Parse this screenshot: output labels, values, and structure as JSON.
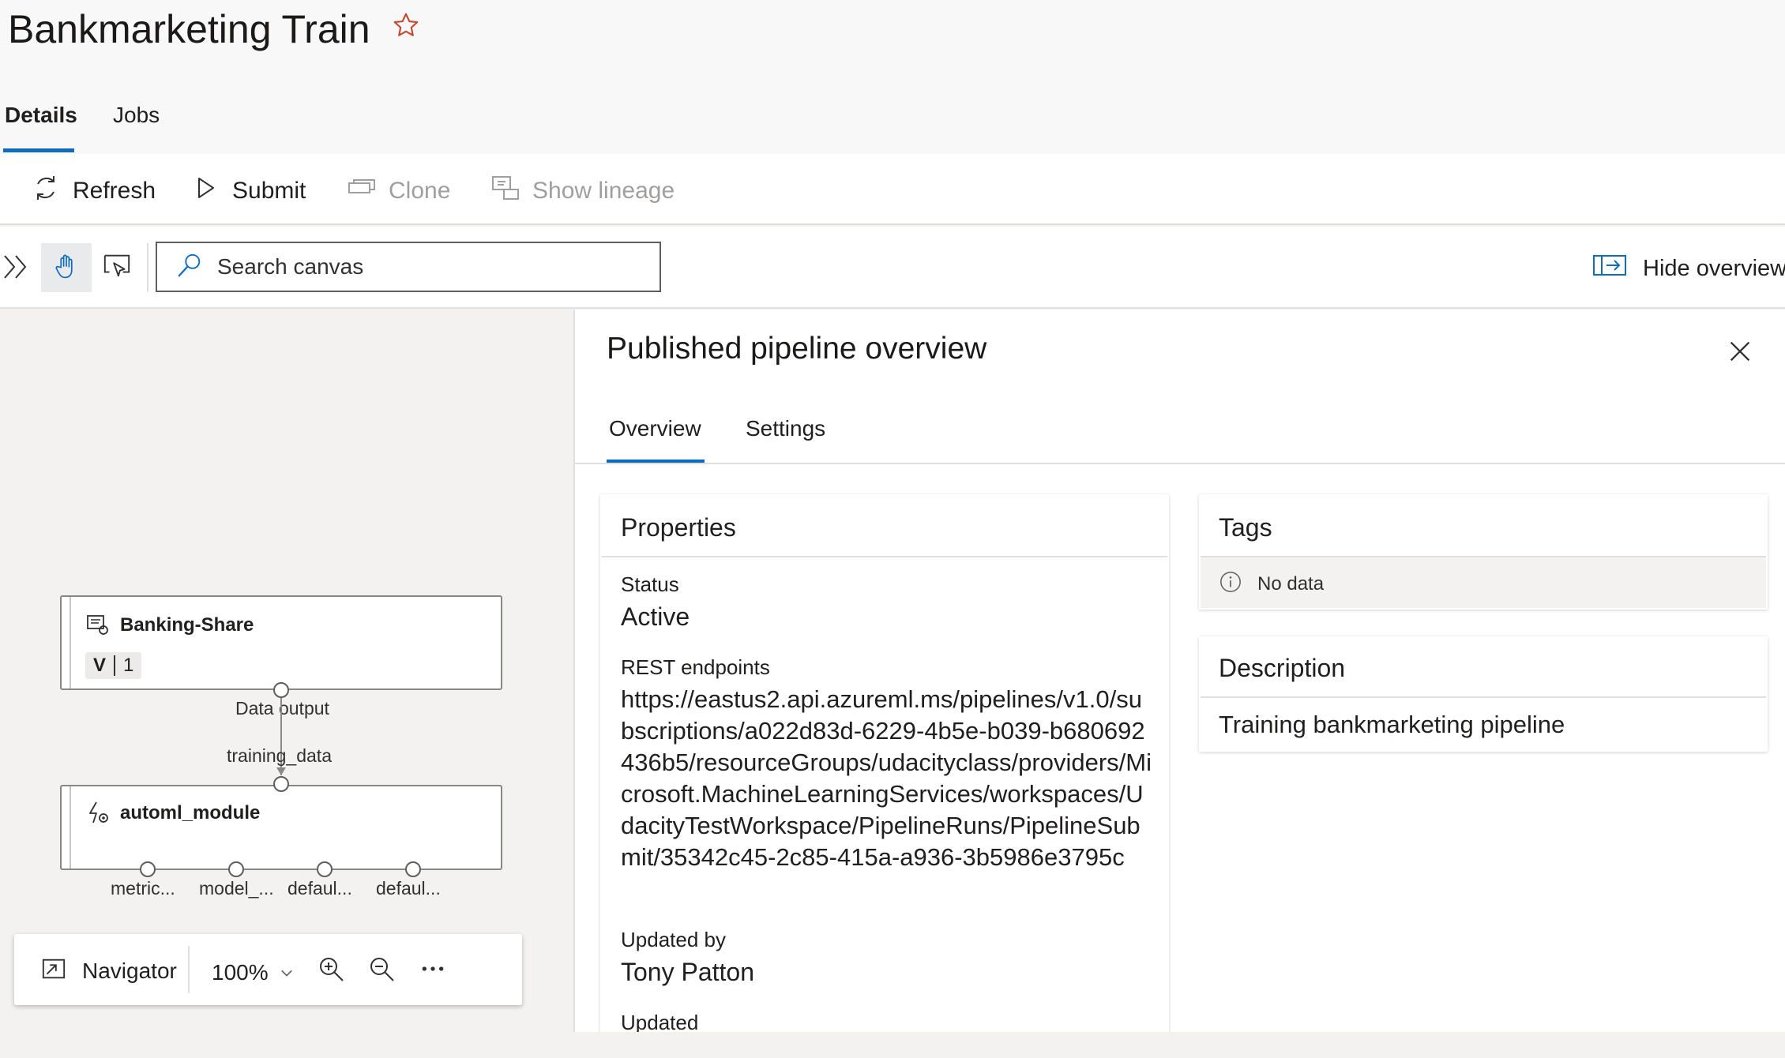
{
  "header": {
    "title": "Bankmarketing Train",
    "tabs": [
      {
        "label": "Details",
        "active": true
      },
      {
        "label": "Jobs",
        "active": false
      }
    ]
  },
  "toolbar": {
    "refresh_label": "Refresh",
    "submit_label": "Submit",
    "clone_label": "Clone",
    "show_lineage_label": "Show lineage"
  },
  "canvas_toolbar": {
    "search_placeholder": "Search canvas",
    "hide_overview_label": "Hide overview"
  },
  "canvas": {
    "nodes": [
      {
        "title": "Banking-Share",
        "version_prefix": "V",
        "version": "1",
        "output_label": "Data output"
      },
      {
        "title": "automl_module",
        "input_label": "training_data",
        "outputs": [
          "metric...",
          "model_...",
          "defaul...",
          "defaul..."
        ]
      }
    ],
    "navigator": {
      "label": "Navigator",
      "zoom": "100%"
    }
  },
  "panel": {
    "title": "Published pipeline overview",
    "tabs": [
      {
        "label": "Overview",
        "active": true
      },
      {
        "label": "Settings",
        "active": false
      }
    ],
    "properties": {
      "title": "Properties",
      "status_label": "Status",
      "status_value": "Active",
      "rest_label": "REST endpoints",
      "rest_value": "https://eastus2.api.azureml.ms/pipelines/v1.0/subscriptions/a022d83d-6229-4b5e-b039-b680692436b5/resourceGroups/udacityclass/providers/Microsoft.MachineLearningServices/workspaces/UdacityTestWorkspace/PipelineRuns/PipelineSubmit/35342c45-2c85-415a-a936-3b5986e3795c",
      "updated_by_label": "Updated by",
      "updated_by_value": "Tony Patton",
      "updated_label": "Updated"
    },
    "tags": {
      "title": "Tags",
      "empty_text": "No data"
    },
    "description": {
      "title": "Description",
      "text": "Training bankmarketing pipeline"
    }
  },
  "colors": {
    "accent": "#0f6cbd",
    "star": "#c4472d",
    "disabled": "#a19f9d"
  },
  "icons": [
    "star-icon",
    "refresh-icon",
    "play-icon",
    "clone-icon",
    "lineage-icon",
    "double-chevron-icon",
    "hand-icon",
    "select-icon",
    "search-icon",
    "hide-overview-icon",
    "close-icon",
    "dataset-icon",
    "automl-icon",
    "info-icon",
    "navigator-icon",
    "zoom-in-icon",
    "zoom-out-icon",
    "more-icon",
    "chevron-down-icon"
  ]
}
